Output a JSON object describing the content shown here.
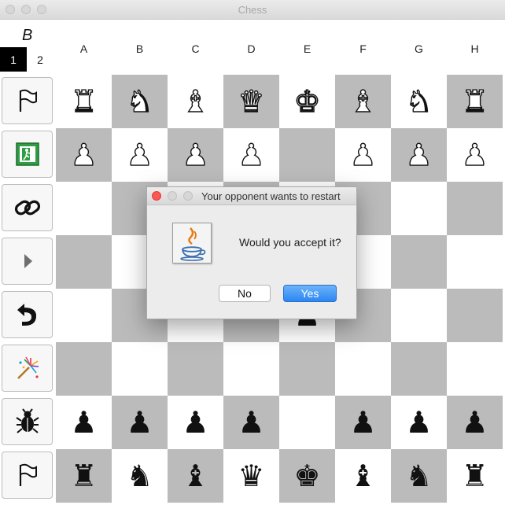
{
  "window": {
    "title": "Chess"
  },
  "player": {
    "label": "B",
    "tabs": [
      "1",
      "2"
    ]
  },
  "sidebar": {
    "buttons": [
      {
        "name": "flag-button",
        "icon": "flag-icon"
      },
      {
        "name": "exit-button",
        "icon": "exit-icon"
      },
      {
        "name": "connect-button",
        "icon": "link-icon"
      },
      {
        "name": "play-button",
        "icon": "play-icon"
      },
      {
        "name": "undo-button",
        "icon": "undo-icon"
      },
      {
        "name": "magic-button",
        "icon": "magic-wand-icon"
      },
      {
        "name": "debug-button",
        "icon": "bug-icon"
      },
      {
        "name": "flag-bottom-button",
        "icon": "flag-icon"
      }
    ]
  },
  "board": {
    "columns": [
      "A",
      "B",
      "C",
      "D",
      "E",
      "F",
      "G",
      "H"
    ],
    "rows": [
      [
        "♜",
        "♞",
        "♝",
        "♛",
        "♚",
        "♝",
        "♞",
        "♜"
      ],
      [
        "♟",
        "♟",
        "♟",
        "♟",
        "",
        "♟",
        "♟",
        "♟"
      ],
      [
        "",
        "",
        "",
        "",
        "",
        "",
        "",
        ""
      ],
      [
        "",
        "",
        "",
        "",
        "",
        "",
        "",
        ""
      ],
      [
        "",
        "",
        "",
        "",
        "♟",
        "",
        "",
        ""
      ],
      [
        "",
        "",
        "",
        "",
        "",
        "",
        "",
        ""
      ],
      [
        "♟",
        "♟",
        "♟",
        "♟",
        "",
        "♟",
        "♟",
        "♟"
      ],
      [
        "♜",
        "♞",
        "♝",
        "♛",
        "♚",
        "♝",
        "♞",
        "♜"
      ]
    ],
    "row_colors": [
      "white",
      "white",
      "",
      "",
      "black",
      "",
      "black",
      "black"
    ]
  },
  "dialog": {
    "title": "Your opponent wants to restart",
    "message": "Would you accept it?",
    "icon": "java-icon",
    "no_label": "No",
    "yes_label": "Yes"
  },
  "colors": {
    "dark_square": "#bbbbbb",
    "light_square": "#ffffff",
    "accent": "#3d8ef5"
  }
}
